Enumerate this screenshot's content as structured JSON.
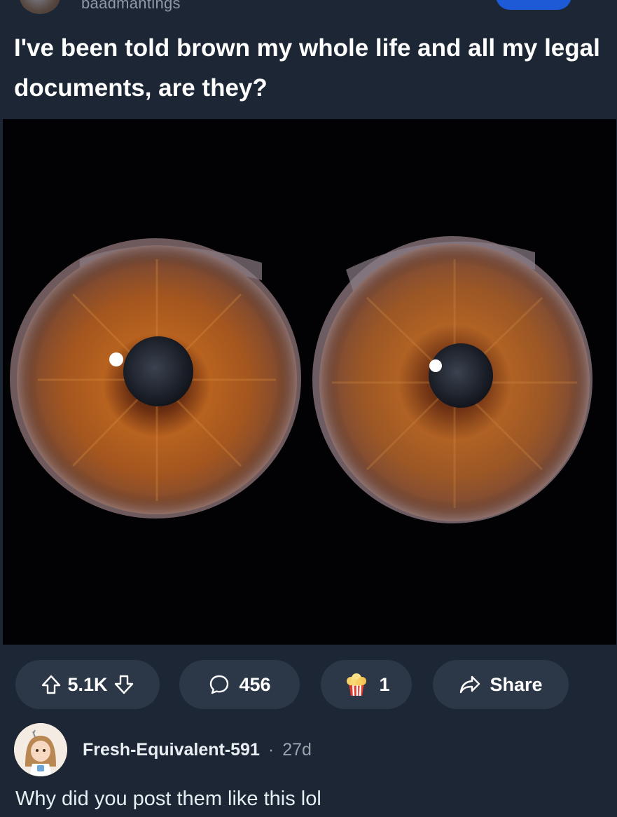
{
  "post": {
    "username": "baadmantings",
    "title": "I've been told brown my whole life and all my legal documents, are they?",
    "image_icon": "two-brown-irises-image"
  },
  "actions": {
    "vote_count": "5.1K",
    "comment_count": "456",
    "award_count": "1",
    "share_label": "Share",
    "icons": {
      "upvote": "arrow-up-icon",
      "downvote": "arrow-down-icon",
      "comment": "speech-bubble-icon",
      "award": "popcorn-award-icon",
      "share": "share-arrow-icon"
    }
  },
  "comment": {
    "author": "Fresh-Equivalent-591",
    "separator": "·",
    "age": "27d",
    "body": "Why did you post them like this lol"
  },
  "colors": {
    "background": "#1c2634",
    "pill": "#2c3847",
    "accent_button": "#1d5bd6",
    "iris": "#a0521f"
  }
}
